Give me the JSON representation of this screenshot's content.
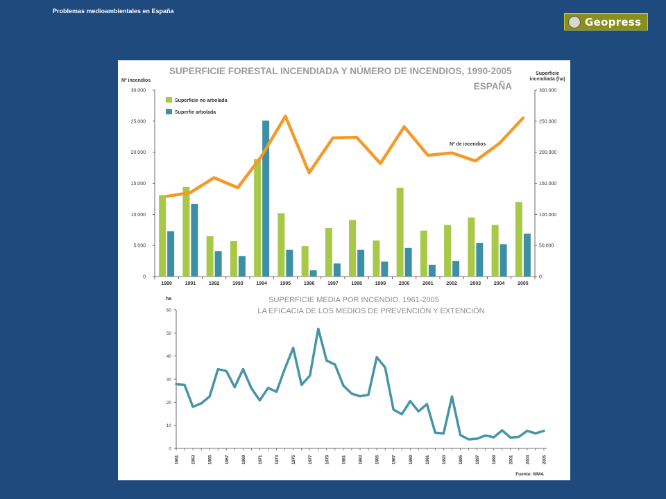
{
  "header": {
    "title": "Problemas medioambientales en España"
  },
  "logo": {
    "text": "Geopress"
  },
  "colors": {
    "background": "#1f4a7e",
    "no_arbolada": "#a8c848",
    "arbolada": "#3d8fa6",
    "incendios": "#f39a2a",
    "media": "#4794a8"
  },
  "chart_data": [
    {
      "type": "bar",
      "title": "SUPERFICIE FORESTAL INCENDIADA Y NÚMERO DE INCENDIOS, 1990-2005",
      "subtitle": "ESPAÑA",
      "ylabel_left": "Nº incendios",
      "ylabel_right": "Superficie incendiada (ha)",
      "ylim_left": [
        0,
        30000
      ],
      "ylim_right": [
        0,
        300000
      ],
      "yticks_left": [
        "0",
        "5.000",
        "10.000",
        "15.000",
        "20.000",
        "25.000",
        "30.000"
      ],
      "yticks_right": [
        "0",
        "50.000",
        "100.000",
        "150.000",
        "200.000",
        "250.000",
        "300.000"
      ],
      "categories": [
        "1990",
        "1991",
        "1992",
        "1993",
        "1994",
        "1995",
        "1996",
        "1997",
        "1998",
        "1999",
        "2000",
        "2001",
        "2002",
        "2003",
        "2004",
        "2005"
      ],
      "legend_placement": "top-left",
      "series": [
        {
          "name": "Superficie no arbolada",
          "type": "bar",
          "axis": "right",
          "values": [
            131000,
            144000,
            65000,
            57000,
            189000,
            102000,
            49000,
            78000,
            91000,
            58000,
            143000,
            74000,
            83000,
            95000,
            83000,
            120000
          ]
        },
        {
          "name": "Superfie arbolada",
          "type": "bar",
          "axis": "right",
          "values": [
            73000,
            117000,
            41000,
            33000,
            251000,
            43000,
            10000,
            21000,
            43000,
            24000,
            46000,
            19000,
            25000,
            54000,
            52000,
            69000
          ]
        },
        {
          "name": "Nº de incendios",
          "type": "line",
          "axis": "left",
          "values": [
            12900,
            13500,
            15900,
            14300,
            19400,
            25800,
            16700,
            22300,
            22400,
            18200,
            24100,
            19500,
            19900,
            18600,
            21400,
            25500
          ]
        }
      ]
    },
    {
      "type": "line",
      "title": "SUPERFICIE MEDIA POR INCENDIO. 1961-2005",
      "subtitle": "LA EFICACIA DE LOS MEDIOS DE PREVENCIÓN Y EXTENCIÓN",
      "ylabel": "ha",
      "ylim": [
        0,
        60
      ],
      "yticks": [
        "0",
        "10",
        "20",
        "30",
        "40",
        "50",
        "60"
      ],
      "xticks": [
        "1961",
        "1963",
        "1965",
        "1967",
        "1969",
        "1971",
        "1973",
        "1975",
        "1977",
        "1979",
        "1981",
        "1983",
        "1985",
        "1987",
        "1989",
        "1991",
        "1993",
        "1995",
        "1997",
        "1999",
        "2001",
        "2003",
        "2005"
      ],
      "source": "Fuente: MMA",
      "x": [
        1961,
        1962,
        1963,
        1964,
        1965,
        1966,
        1967,
        1968,
        1969,
        1970,
        1971,
        1972,
        1973,
        1974,
        1975,
        1976,
        1977,
        1978,
        1979,
        1980,
        1981,
        1982,
        1983,
        1984,
        1985,
        1986,
        1987,
        1988,
        1989,
        1990,
        1991,
        1992,
        1993,
        1994,
        1995,
        1996,
        1997,
        1998,
        1999,
        2000,
        2001,
        2002,
        2003,
        2004,
        2005
      ],
      "series": [
        {
          "values": [
            27.8,
            27.5,
            18,
            19.5,
            22.5,
            34.3,
            33.5,
            26.5,
            34.3,
            26,
            20.8,
            26.2,
            24.5,
            34.5,
            43.5,
            27.5,
            31.5,
            51.8,
            38,
            36.3,
            27.2,
            23.7,
            22.6,
            23.2,
            39.5,
            35,
            16.8,
            14.8,
            20.5,
            16,
            19.2,
            6.8,
            6.5,
            22.5,
            5.8,
            3.9,
            4.2,
            5.6,
            4.8,
            7.8,
            4.7,
            5,
            7.6,
            6.5,
            7.6
          ]
        }
      ]
    }
  ]
}
